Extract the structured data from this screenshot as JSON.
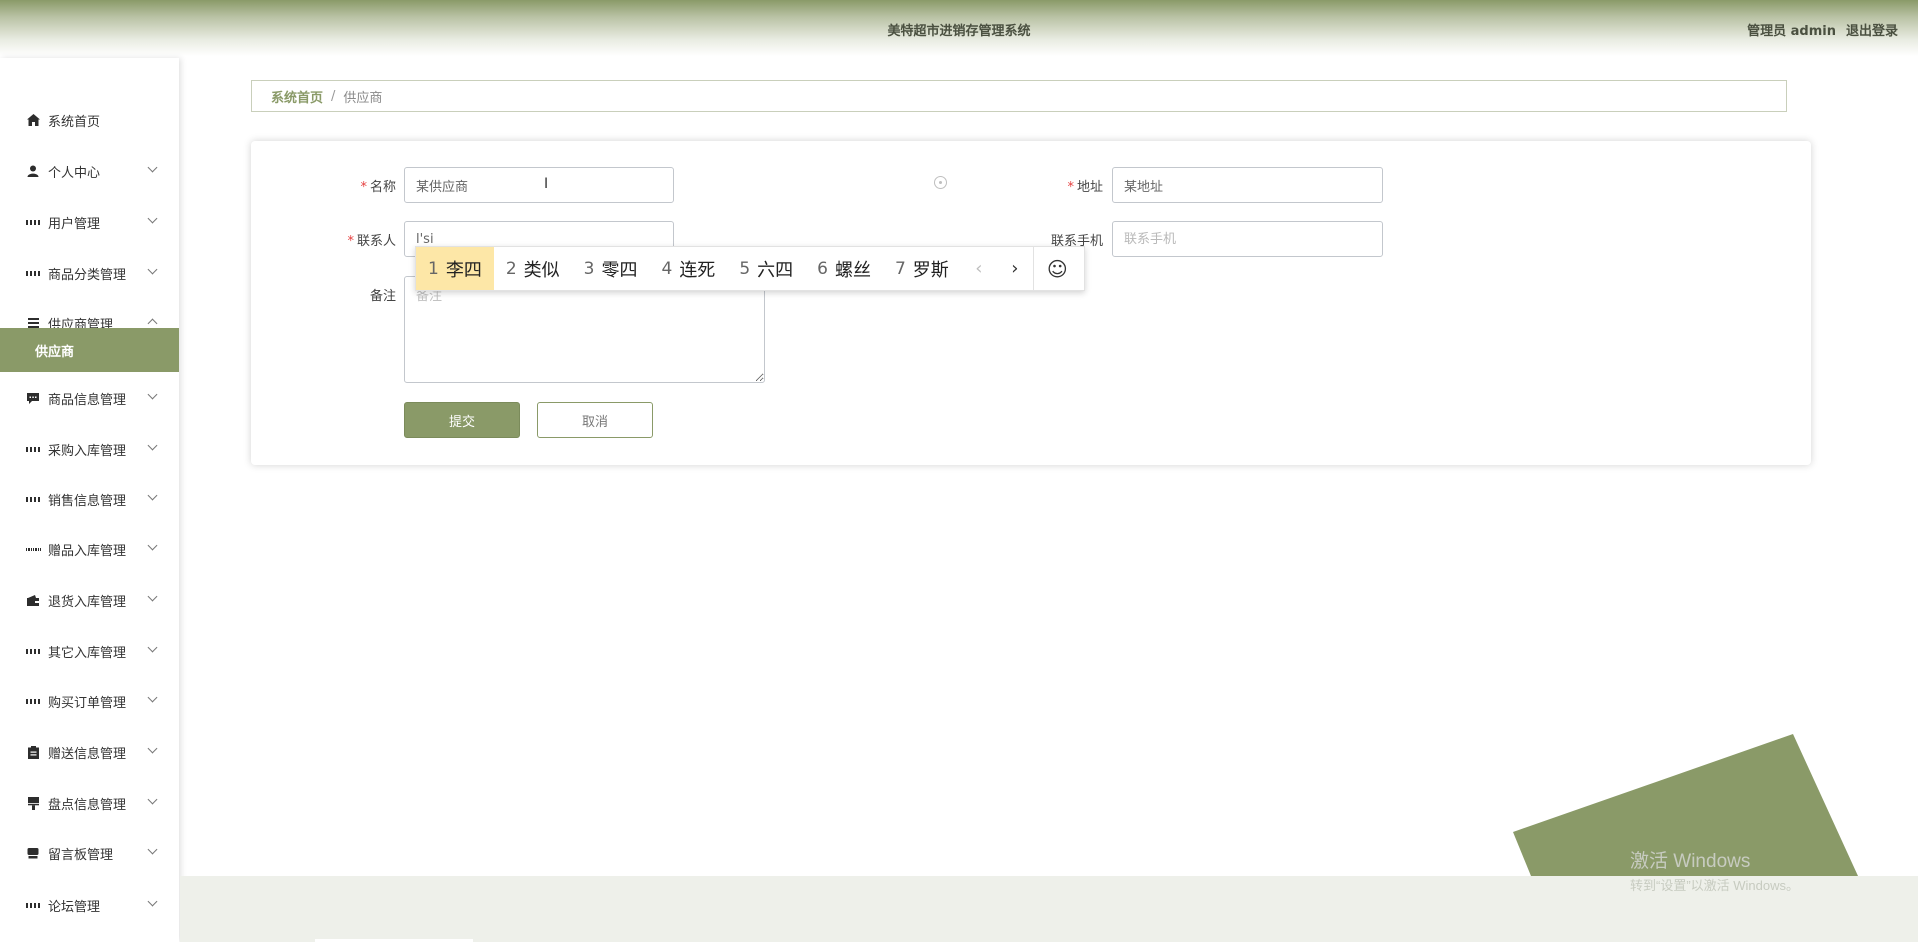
{
  "header": {
    "title": "美特超市进销存管理系统",
    "user_label": "管理员 admin",
    "logout_label": "退出登录"
  },
  "sidebar": {
    "items": [
      {
        "label": "系统首页",
        "icon": "home-icon"
      },
      {
        "label": "个人中心",
        "icon": "user-icon"
      },
      {
        "label": "用户管理",
        "icon": "grid-icon"
      },
      {
        "label": "商品分类管理",
        "icon": "grid-icon"
      },
      {
        "label": "供应商管理",
        "icon": "list-icon"
      },
      {
        "label": "供应商",
        "active": true
      },
      {
        "label": "商品信息管理",
        "icon": "message-icon"
      },
      {
        "label": "采购入库管理",
        "icon": "grid-icon"
      },
      {
        "label": "销售信息管理",
        "icon": "grid-icon"
      },
      {
        "label": "赠品入库管理",
        "icon": "grid9-icon"
      },
      {
        "label": "退货入库管理",
        "icon": "wallet-icon"
      },
      {
        "label": "其它入库管理",
        "icon": "grid-icon"
      },
      {
        "label": "购买订单管理",
        "icon": "grid-icon"
      },
      {
        "label": "赠送信息管理",
        "icon": "clipboard-icon"
      },
      {
        "label": "盘点信息管理",
        "icon": "brush-icon"
      },
      {
        "label": "留言板管理",
        "icon": "chat-icon"
      },
      {
        "label": "论坛管理",
        "icon": "grid-icon"
      }
    ]
  },
  "breadcrumb": {
    "home": "系统首页",
    "separator": "/",
    "current": "供应商"
  },
  "form": {
    "name_label": "名称",
    "name_value": "某供应商",
    "address_label": "地址",
    "address_value": "某地址",
    "contact_label": "联系人",
    "contact_value": "l'si",
    "phone_label": "联系手机",
    "phone_placeholder": "联系手机",
    "remark_label": "备注",
    "remark_placeholder": "备注",
    "submit_label": "提交",
    "cancel_label": "取消"
  },
  "ime": {
    "candidates": [
      {
        "num": "1",
        "text": "李四",
        "active": true
      },
      {
        "num": "2",
        "text": "类似"
      },
      {
        "num": "3",
        "text": "零四"
      },
      {
        "num": "4",
        "text": "连死"
      },
      {
        "num": "5",
        "text": "六四"
      },
      {
        "num": "6",
        "text": "螺丝"
      },
      {
        "num": "7",
        "text": "罗斯"
      }
    ],
    "prev": "‹",
    "next": "›",
    "emoji": "☺"
  },
  "watermark": {
    "line1": "激活 Windows",
    "line2": "转到“设置”以激活 Windows。"
  },
  "colors": {
    "accent": "#8a9a68",
    "required": "#e53e3e",
    "ime_highlight": "#fde7a7"
  }
}
